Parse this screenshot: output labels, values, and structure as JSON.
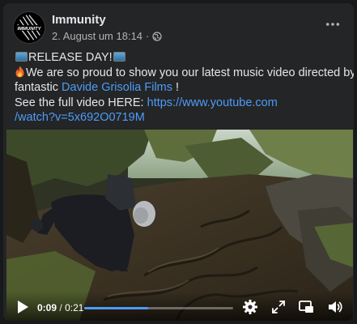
{
  "post": {
    "page_name": "Immunity",
    "timestamp": "2. August um 18:14",
    "dot": "·",
    "avatar_logo_text": "IMMUNITY",
    "text": {
      "line1": "RELEASE DAY!",
      "line2_a": "We are so proud to show you our latest music video directed by the",
      "line3_a": "fantastic ",
      "line3_link": "Davide Grisolia Films",
      "line3_b": " !",
      "line4_a": "See the full video HERE: ",
      "line4_link": "https://www.youtube.com",
      "line5_link": "/watch?v=5x692O0719M"
    }
  },
  "video": {
    "current_time": "0:09",
    "separator": "/",
    "duration": "0:21",
    "progress_fraction": 0.43
  },
  "icons": {
    "more": "more-horizontal-icon",
    "audience": "globe-icon",
    "play": "play-icon",
    "settings": "gear-icon",
    "fullscreen": "expand-icon",
    "pip": "picture-in-picture-icon",
    "volume": "volume-icon"
  },
  "colors": {
    "card_bg": "#242526",
    "text_primary": "#e4e6eb",
    "text_secondary": "#b0b3b8",
    "link": "#4d9cf8"
  }
}
